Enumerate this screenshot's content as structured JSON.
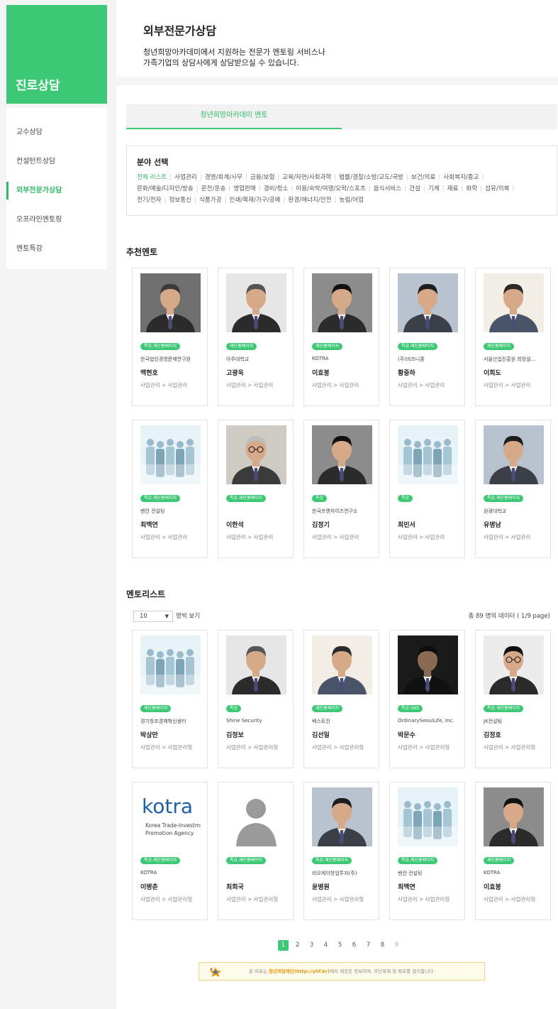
{
  "sidebar": {
    "title": "진로상담",
    "items": [
      {
        "label": "교수상담",
        "active": false
      },
      {
        "label": "컨설턴트상담",
        "active": false
      },
      {
        "label": "외부전문가상담",
        "active": true
      },
      {
        "label": "오프라인멘토링",
        "active": false
      },
      {
        "label": "멘토특강",
        "active": false
      }
    ]
  },
  "header": {
    "title": "외부전문가상담",
    "desc_line1": "청년희망아카데미에서 지원하는 전문가 멘토링 서비스나",
    "desc_line2": "가족기업의 상담사에게 상담받으실 수 있습니다."
  },
  "tabs": [
    {
      "label": "청년희망아카데미 멘토",
      "active": true
    }
  ],
  "field_select": {
    "title": "분야 선택",
    "options": [
      "전체 리스트",
      "사업관리",
      "경영/회계/사무",
      "금융/보험",
      "교육/자연/사회과학",
      "법률/경찰/소방/교도/국방",
      "보건/의료",
      "사회복지/종교",
      "문화/예술/디자인/방송",
      "운전/운송",
      "영업판매",
      "경비/청소",
      "이용/숙박/여행/오락/스포츠",
      "음식서비스",
      "건설",
      "기계",
      "재료",
      "화학",
      "섬유/의복",
      "전기/전자",
      "정보통신",
      "식품가공",
      "인쇄/목재/가구/공예",
      "환경/에너지/안전",
      "농림/어업"
    ],
    "selected": "전체 리스트"
  },
  "recommended": {
    "title": "추천멘토",
    "mentors": [
      {
        "badge": "특강,재단홈페이지",
        "org": "한국법인경영문제연구원",
        "name": "백현호",
        "category": "사업관리 > 사업관리",
        "photo": "man-grey"
      },
      {
        "badge": "재단홈페이지",
        "org": "아주대학교",
        "name": "고광욱",
        "category": "사업관리 > 사업관리",
        "photo": "man-older"
      },
      {
        "badge": "재단홈페이지",
        "org": "KOTRA",
        "name": "이효봉",
        "category": "사업관리 > 사업관리",
        "photo": "man-young"
      },
      {
        "badge": "특강,재단홈페이지",
        "org": "(주)비즈니콤",
        "name": "황중하",
        "category": "사업관리 > 사업관리",
        "photo": "man-mid"
      },
      {
        "badge": "재단홈페이지",
        "org": "서울산업진흥원 희망설...",
        "name": "이희도",
        "category": "사업관리 > 사업관리",
        "photo": "man-frame"
      },
      {
        "badge": "특강,재단홈페이지",
        "org": "벤칸 컨설팅",
        "name": "최백연",
        "category": "사업관리 > 사업관리",
        "photo": "placeholder-group"
      },
      {
        "badge": "특강,재단홈페이지",
        "org": "",
        "name": "이한석",
        "category": "사업관리 > 사업관리",
        "photo": "man-glasses-old"
      },
      {
        "badge": "특강",
        "org": "한국프랜차이즈연구소",
        "name": "김정기",
        "category": "사업관리 > 사업관리",
        "photo": "man-young"
      },
      {
        "badge": "특강",
        "org": "",
        "name": "최민서",
        "category": "사업관리 > 사업관리",
        "photo": "placeholder-group"
      },
      {
        "badge": "특강,재단홈페이지",
        "org": "원광대학교",
        "name": "유병남",
        "category": "사업관리 > 사업관리",
        "photo": "man-mid"
      }
    ]
  },
  "mentor_list": {
    "title": "멘토리스트",
    "page_size": "10",
    "page_size_suffix": "명씩 보기",
    "total_text": "총 89 명의 데이터 ( 1/9 page)",
    "mentors": [
      {
        "badge": "재단홈페이지",
        "org": "경기창조경제혁신센터",
        "name": "박상만",
        "category": "사업관리 > 사업관리형",
        "photo": "placeholder-group"
      },
      {
        "badge": "특강",
        "org": "Shine Security",
        "name": "김정보",
        "category": "사업관리 > 사업관리형",
        "photo": "man-older"
      },
      {
        "badge": "재단홈페이지",
        "org": "베스트인",
        "name": "김선일",
        "category": "사업관리 > 사업관리형",
        "photo": "man-frame"
      },
      {
        "badge": "특강,SNS",
        "org": "OrdinarySeoulLife, Inc.",
        "name": "박문수",
        "category": "사업관리 > 사업관리형",
        "photo": "man-dark"
      },
      {
        "badge": "특강,재단홈페이지",
        "org": "JK컨설팅",
        "name": "김정호",
        "category": "사업관리 > 사업관리형",
        "photo": "man-glasses"
      },
      {
        "badge": "특강,재단홈페이지",
        "org": "KOTRA",
        "name": "이병춘",
        "category": "사업관리 > 사업관리형",
        "photo": "kotra-logo"
      },
      {
        "badge": "특강,재단홈페이지",
        "org": "",
        "name": "최희국",
        "category": "사업관리 > 사업관리형",
        "photo": "silhouette"
      },
      {
        "badge": "특강,재단홈페이지",
        "org": "비오케이창업투자(주)",
        "name": "윤병원",
        "category": "사업관리 > 사업관리형",
        "photo": "man-mid"
      },
      {
        "badge": "특강,재단홈페이지",
        "org": "벤칸 컨설팅",
        "name": "최백연",
        "category": "사업관리 > 사업관리형",
        "photo": "placeholder-group"
      },
      {
        "badge": "재단홈페이지",
        "org": "KOTRA",
        "name": "이효봉",
        "category": "사업관리 > 사업관리형",
        "photo": "man-young"
      }
    ]
  },
  "kotra_logo": {
    "word": "kotra",
    "line1": "Korea Trade-Investment",
    "line2": "Promotion Agency"
  },
  "pagination": {
    "pages": [
      "1",
      "2",
      "3",
      "4",
      "5",
      "6",
      "7",
      "8",
      "9"
    ],
    "current": "1"
  },
  "notice": {
    "prefix": "본 자료는 ",
    "highlight": "청년희망재단(http://yhf.kr)",
    "suffix": "에서 제공된 정보이며, 무단복제 및 배포를 금지합니다."
  },
  "colors": {
    "accent": "#3dc876",
    "accent_text": "#2fb866",
    "notice_highlight": "#e8960c"
  }
}
